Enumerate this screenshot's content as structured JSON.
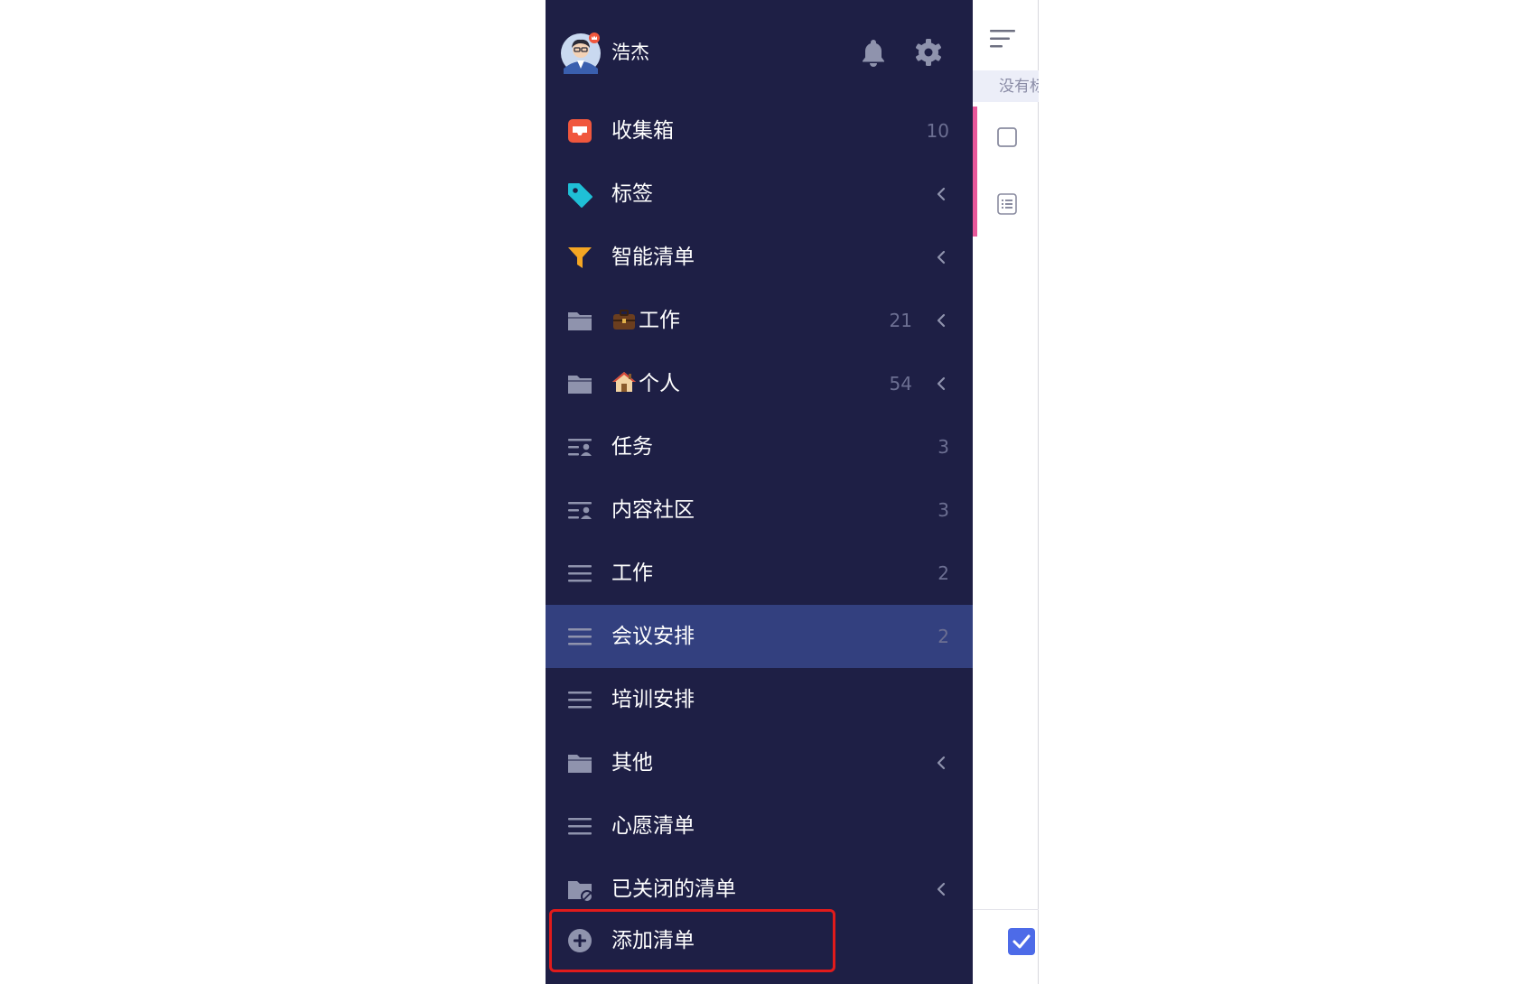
{
  "user": {
    "name": "浩杰"
  },
  "items": [
    {
      "label": "收集箱",
      "emoji": "",
      "count": "10",
      "chevron": false,
      "icon": "inbox-icon"
    },
    {
      "label": "标签",
      "emoji": "",
      "count": "",
      "chevron": true,
      "icon": "tag-icon"
    },
    {
      "label": "智能清单",
      "emoji": "",
      "count": "",
      "chevron": true,
      "icon": "filter-icon"
    },
    {
      "label": "工作",
      "emoji": "💼",
      "count": "21",
      "chevron": true,
      "icon": "folder-icon"
    },
    {
      "label": "个人",
      "emoji": "🏠",
      "count": "54",
      "chevron": true,
      "icon": "folder-icon"
    },
    {
      "label": "任务",
      "emoji": "",
      "count": "3",
      "chevron": false,
      "icon": "shared-list-icon"
    },
    {
      "label": "内容社区",
      "emoji": "",
      "count": "3",
      "chevron": false,
      "icon": "shared-list-icon"
    },
    {
      "label": "工作",
      "emoji": "",
      "count": "2",
      "chevron": false,
      "icon": "list-icon"
    },
    {
      "label": "会议安排",
      "emoji": "",
      "count": "2",
      "chevron": false,
      "icon": "list-icon",
      "active": true
    },
    {
      "label": "培训安排",
      "emoji": "",
      "count": "",
      "chevron": false,
      "icon": "list-icon"
    },
    {
      "label": "其他",
      "emoji": "",
      "count": "",
      "chevron": true,
      "icon": "folder-icon"
    },
    {
      "label": "心愿清单",
      "emoji": "",
      "count": "",
      "chevron": false,
      "icon": "list-icon"
    },
    {
      "label": "已关闭的清单",
      "emoji": "",
      "count": "",
      "chevron": true,
      "icon": "closed-folder-icon"
    }
  ],
  "add_list": {
    "label": "添加清单",
    "icon": "plus-circle-icon"
  },
  "right_panel": {
    "hint_text": "没有标"
  },
  "colors": {
    "sidebar_bg": "#1e1f45",
    "active_row": "#33407f",
    "inbox": "#f0573d",
    "tag": "#1fbfd6",
    "filter": "#f5a623",
    "highlight_border": "#e11b1b",
    "accent_pink": "#e8579a",
    "checkbox_blue": "#4d6be8"
  }
}
